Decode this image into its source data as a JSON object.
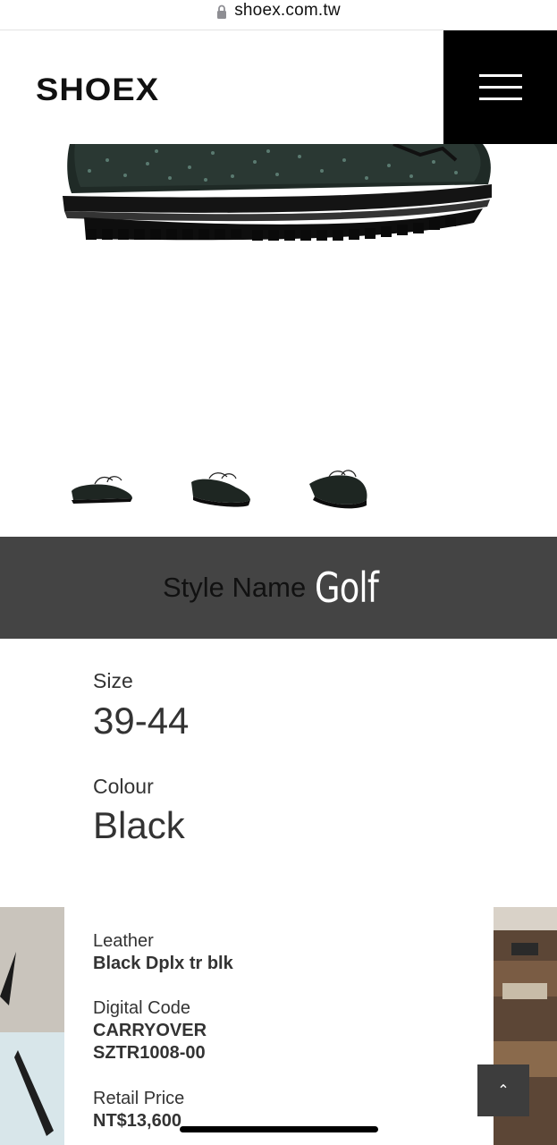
{
  "browser": {
    "url": "shoex.com.tw"
  },
  "header": {
    "logo": "SHOEX"
  },
  "product": {
    "style_label": "Style Name",
    "style_name": "Golf",
    "size_label": "Size",
    "size_value": "39-44",
    "colour_label": "Colour",
    "colour_value": "Black",
    "leather_label": "Leather",
    "leather_value": "Black Dplx tr blk",
    "code_label": "Digital Code",
    "code_value_1": "CARRYOVER",
    "code_value_2": "SZTR1008-00",
    "price_label": "Retail Price",
    "price_value": "NT$13,600"
  },
  "thumbnails": [
    "shoe-side-view",
    "shoe-angle-view",
    "shoe-front-view"
  ],
  "icons": {
    "lock": "lock-icon",
    "menu": "hamburger-icon",
    "to_top": "chevron-up-icon"
  },
  "colors": {
    "header_button": "#000000",
    "style_band": "#444444",
    "to_top_button": "#3d3d3d"
  }
}
